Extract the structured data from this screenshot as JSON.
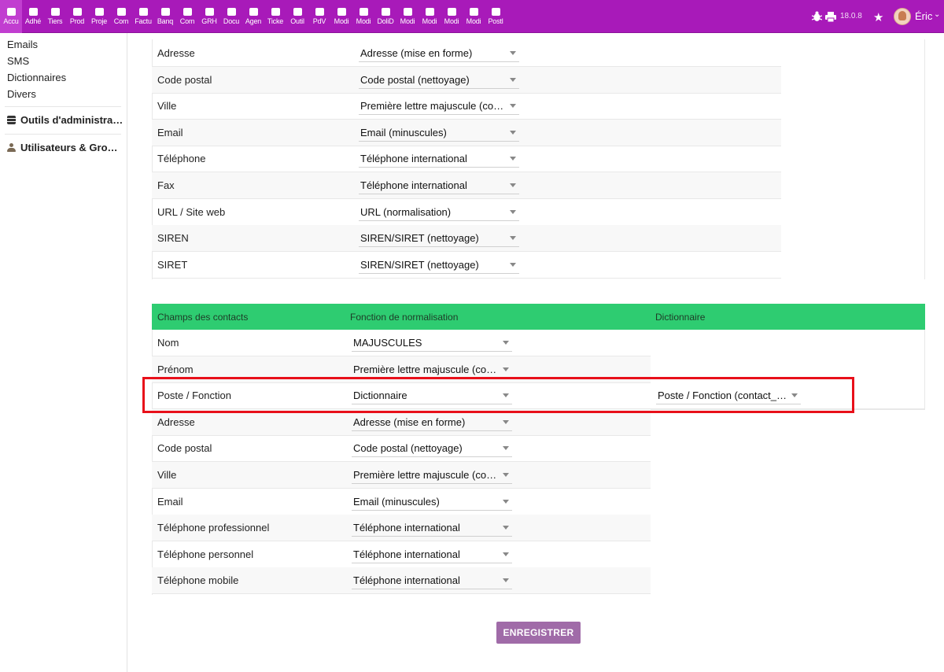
{
  "topbar": {
    "menu": [
      "Accu",
      "Adhé",
      "Tiers",
      "Prod",
      "Proje",
      "Com",
      "Factu",
      "Banq",
      "Com",
      "GRH",
      "Docu",
      "Agen",
      "Ticke",
      "Outil",
      "PdV",
      "Modi",
      "Modi",
      "DoliD",
      "Modi",
      "Modi",
      "Modi",
      "Modi",
      "Postl"
    ],
    "version": "18.0.8",
    "user_name": "Éric",
    "accent_color": "#a81ab9"
  },
  "sidebar": {
    "links": [
      "Emails",
      "SMS",
      "Dictionnaires",
      "Divers"
    ],
    "sections": [
      "Outils d'administrati…",
      "Utilisateurs & Group…"
    ]
  },
  "company_fields": [
    {
      "label": "Adresse",
      "value": "Adresse (mise en forme)"
    },
    {
      "label": "Code postal",
      "value": "Code postal (nettoyage)"
    },
    {
      "label": "Ville",
      "value": "Première lettre majuscule (compo…"
    },
    {
      "label": "Email",
      "value": "Email (minuscules)"
    },
    {
      "label": "Téléphone",
      "value": "Téléphone international"
    },
    {
      "label": "Fax",
      "value": "Téléphone international"
    },
    {
      "label": "URL / Site web",
      "value": "URL (normalisation)"
    },
    {
      "label": "SIREN",
      "value": "SIREN/SIRET (nettoyage)"
    },
    {
      "label": "SIRET",
      "value": "SIREN/SIRET (nettoyage)"
    }
  ],
  "contacts_table": {
    "headers": [
      "Champs des contacts",
      "Fonction de normalisation",
      "Dictionnaire"
    ],
    "header_color": "#2ecc71",
    "rows": [
      {
        "label": "Nom",
        "value": "MAJUSCULES"
      },
      {
        "label": "Prénom",
        "value": "Première lettre majuscule (compo…"
      },
      {
        "label": "Poste / Fonction",
        "value": "Dictionnaire",
        "dictionary": "Poste / Fonction (contact_pos…"
      },
      {
        "label": "Adresse",
        "value": "Adresse (mise en forme)"
      },
      {
        "label": "Code postal",
        "value": "Code postal (nettoyage)"
      },
      {
        "label": "Ville",
        "value": "Première lettre majuscule (compo…"
      },
      {
        "label": "Email",
        "value": "Email (minuscules)"
      },
      {
        "label": "Téléphone professionnel",
        "value": "Téléphone international"
      },
      {
        "label": "Téléphone personnel",
        "value": "Téléphone international"
      },
      {
        "label": "Téléphone mobile",
        "value": "Téléphone international"
      }
    ]
  },
  "save_label": "ENREGISTRER"
}
